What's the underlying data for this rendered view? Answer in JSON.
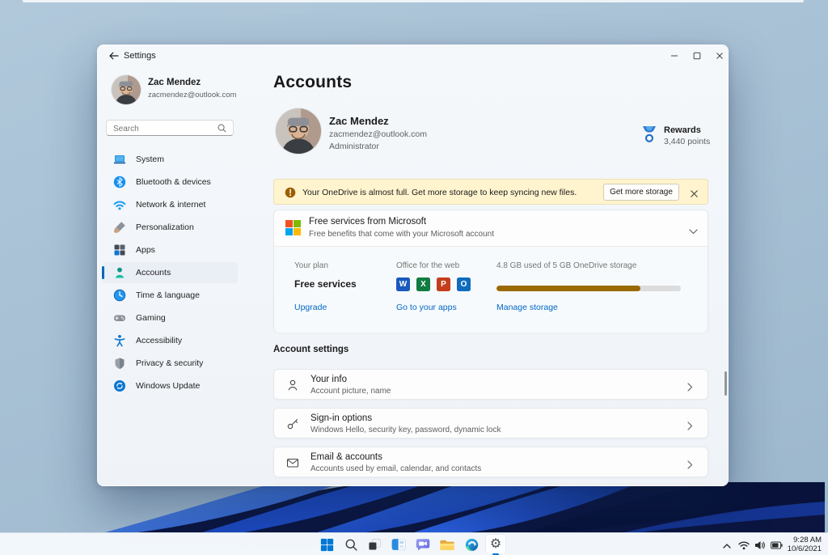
{
  "titlebar": {
    "title": "Settings"
  },
  "sidebar": {
    "user": {
      "name": "Zac Mendez",
      "email": "zacmendez@outlook.com"
    },
    "search": {
      "placeholder": "Search"
    },
    "items": [
      {
        "label": "System",
        "icon": "laptop-icon",
        "selected": false
      },
      {
        "label": "Bluetooth & devices",
        "icon": "bluetooth-icon",
        "selected": false
      },
      {
        "label": "Network & internet",
        "icon": "wifi-icon",
        "selected": false
      },
      {
        "label": "Personalization",
        "icon": "brush-icon",
        "selected": false
      },
      {
        "label": "Apps",
        "icon": "apps-grid-icon",
        "selected": false
      },
      {
        "label": "Accounts",
        "icon": "person-icon",
        "selected": true
      },
      {
        "label": "Time & language",
        "icon": "clock-icon",
        "selected": false
      },
      {
        "label": "Gaming",
        "icon": "gamepad-icon",
        "selected": false
      },
      {
        "label": "Accessibility",
        "icon": "accessibility-icon",
        "selected": false
      },
      {
        "label": "Privacy & security",
        "icon": "shield-icon",
        "selected": false
      },
      {
        "label": "Windows Update",
        "icon": "update-icon",
        "selected": false
      }
    ]
  },
  "main": {
    "page_title": "Accounts",
    "profile": {
      "name": "Zac Mendez",
      "email": "zacmendez@outlook.com",
      "role": "Administrator"
    },
    "rewards": {
      "label": "Rewards",
      "points": "3,440 points"
    },
    "onedrive_banner": {
      "message": "Your OneDrive is almost full. Get more storage to keep syncing new files.",
      "button": "Get more storage"
    },
    "free_services_card": {
      "title": "Free services from Microsoft",
      "subtitle": "Free benefits that come with your Microsoft account"
    },
    "plan": {
      "your_plan_label": "Your plan",
      "plan_name": "Free services",
      "upgrade_link": "Upgrade",
      "office_label": "Office for the web",
      "office_apps": [
        {
          "name": "Word",
          "letter": "W",
          "color": "#185abd"
        },
        {
          "name": "Excel",
          "letter": "X",
          "color": "#107c41"
        },
        {
          "name": "PowerPoint",
          "letter": "P",
          "color": "#c43e1c"
        },
        {
          "name": "Outlook",
          "letter": "O",
          "color": "#0f6cbd"
        }
      ],
      "apps_link": "Go to your apps",
      "storage_label": "4.8 GB used of 5 GB OneDrive storage",
      "storage_fill": "78%",
      "manage_link": "Manage storage"
    },
    "account_settings": {
      "header": "Account settings",
      "rows": [
        {
          "title": "Your info",
          "subtitle": "Account picture, name",
          "icon": "person-outline-icon"
        },
        {
          "title": "Sign-in options",
          "subtitle": "Windows Hello, security key, password, dynamic lock",
          "icon": "key-icon"
        },
        {
          "title": "Email & accounts",
          "subtitle": "Accounts used by email, calendar, and contacts",
          "icon": "mail-icon"
        }
      ]
    }
  },
  "taskbar": {
    "icons": [
      "start",
      "search",
      "task-view",
      "widgets",
      "chat",
      "file-explorer",
      "edge",
      "settings"
    ],
    "active_icon": "settings",
    "tray": {
      "time": "9:28 AM",
      "date": "10/6/2021"
    }
  },
  "colors": {
    "accent": "#0067c0",
    "link": "#0069c8",
    "storage_bar": "#9a6a00",
    "banner_bg": "#fff4ce",
    "warning": "#9d5d00",
    "selected_nav_bg": "#eaeef5"
  }
}
